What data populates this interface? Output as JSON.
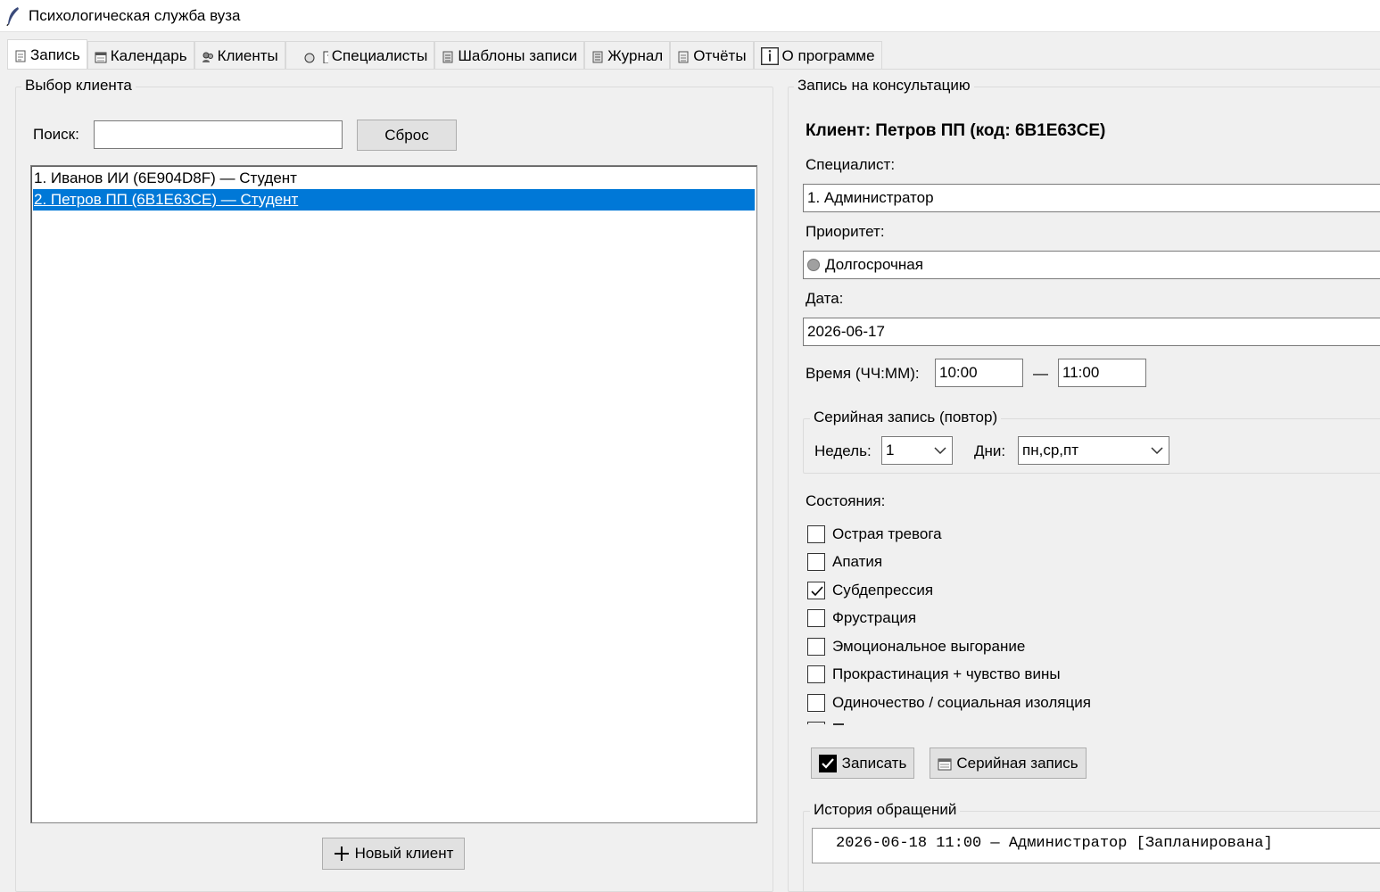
{
  "window": {
    "title": "Психологическая служба вуза"
  },
  "tabs": [
    {
      "label": "Запись",
      "icon": "note-icon",
      "active": true
    },
    {
      "label": "Календарь",
      "icon": "calendar-icon",
      "active": false
    },
    {
      "label": "Клиенты",
      "icon": "clients-icon",
      "active": false
    },
    {
      "label": "Специалисты",
      "icon": "specialist-icon",
      "active": false
    },
    {
      "label": "Шаблоны записи",
      "icon": "template-icon",
      "active": false
    },
    {
      "label": "Журнал",
      "icon": "journal-icon",
      "active": false
    },
    {
      "label": "Отчёты",
      "icon": "report-icon",
      "active": false
    },
    {
      "label": "О программе",
      "icon": "info-icon",
      "active": false
    }
  ],
  "client_select": {
    "group_title": "Выбор клиента",
    "search_label": "Поиск:",
    "search_value": "",
    "reset_label": "Сброс",
    "clients": [
      {
        "text": "1. Иванов ИИ (6E904D8F) — Студент",
        "selected": false
      },
      {
        "text": "2. Петров ПП (6B1E63CE) — Студент",
        "selected": true
      }
    ],
    "new_client_label": "Новый клиент"
  },
  "booking": {
    "group_title": "Запись на консультацию",
    "client_heading": "Клиент: Петров ПП (код: 6B1E63CE)",
    "specialist_label": "Специалист:",
    "specialist_value": "1. Администратор",
    "priority_label": "Приоритет:",
    "priority_value": "Долгосрочная",
    "priority_color": "#a0a0a0",
    "date_label": "Дата:",
    "date_value": "2026-06-17",
    "time_label": "Время (ЧЧ:ММ):",
    "time_from": "10:00",
    "time_dash": "—",
    "time_to": "11:00",
    "series": {
      "group_title": "Серийная запись (повтор)",
      "weeks_label": "Недель:",
      "weeks_value": "1",
      "days_label": "Дни:",
      "days_value": "пн,ср,пт"
    },
    "states_label": "Состояния:",
    "states": [
      {
        "label": "Острая тревога",
        "checked": false
      },
      {
        "label": "Апатия",
        "checked": false
      },
      {
        "label": "Субдепрессия",
        "checked": true
      },
      {
        "label": "Фрустрация",
        "checked": false
      },
      {
        "label": "Эмоциональное выгорание",
        "checked": false
      },
      {
        "label": "Прокрастинация + чувство вины",
        "checked": false
      },
      {
        "label": "Одиночество / социальная изоляция",
        "checked": false
      }
    ],
    "submit_label": "Записать",
    "series_button_label": "Серийная запись"
  },
  "history": {
    "group_title": "История обращений",
    "entries": [
      "2026-06-18 11:00 — Администратор [Запланирована]"
    ]
  },
  "colors": {
    "selection": "#0078d7",
    "window_bg": "#f0f0f0"
  }
}
